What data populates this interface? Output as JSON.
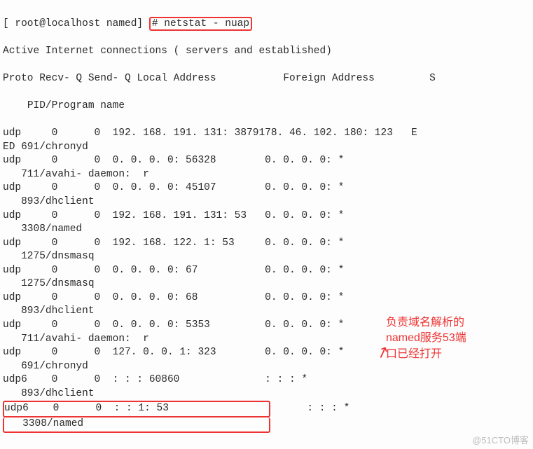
{
  "prompt_prefix": "[ root@localhost named]",
  "prompt_hash": "# ",
  "command": "netstat - nuap",
  "subtitle": "Active Internet connections ( servers and established)",
  "header": {
    "proto": "Proto",
    "recvq": "Recv- Q",
    "sendq": "Send- Q",
    "local": "Local Address",
    "foreign": "Foreign Address",
    "state": "S",
    "pid": "PID/Program name"
  },
  "rows": [
    {
      "proto": "udp",
      "recvq": "0",
      "sendq": "0",
      "local": "192. 168. 191. 131: 38791",
      "foreign": "78. 46. 102. 180: 123",
      "state": "E",
      "pid": "ED 691/chronyd"
    },
    {
      "proto": "udp",
      "recvq": "0",
      "sendq": "0",
      "local": "0. 0. 0. 0: 56328",
      "foreign": "0. 0. 0. 0: *",
      "state": "",
      "pid": "   711/avahi- daemon:  r"
    },
    {
      "proto": "udp",
      "recvq": "0",
      "sendq": "0",
      "local": "0. 0. 0. 0: 45107",
      "foreign": "0. 0. 0. 0: *",
      "state": "",
      "pid": "   893/dhclient"
    },
    {
      "proto": "udp",
      "recvq": "0",
      "sendq": "0",
      "local": "192. 168. 191. 131: 53",
      "foreign": "0. 0. 0. 0: *",
      "state": "",
      "pid": "   3308/named"
    },
    {
      "proto": "udp",
      "recvq": "0",
      "sendq": "0",
      "local": "192. 168. 122. 1: 53",
      "foreign": "0. 0. 0. 0: *",
      "state": "",
      "pid": "   1275/dnsmasq"
    },
    {
      "proto": "udp",
      "recvq": "0",
      "sendq": "0",
      "local": "0. 0. 0. 0: 67",
      "foreign": "0. 0. 0. 0: *",
      "state": "",
      "pid": "   1275/dnsmasq"
    },
    {
      "proto": "udp",
      "recvq": "0",
      "sendq": "0",
      "local": "0. 0. 0. 0: 68",
      "foreign": "0. 0. 0. 0: *",
      "state": "",
      "pid": "   893/dhclient"
    },
    {
      "proto": "udp",
      "recvq": "0",
      "sendq": "0",
      "local": "0. 0. 0. 0: 5353",
      "foreign": "0. 0. 0. 0: *",
      "state": "",
      "pid": "   711/avahi- daemon:  r"
    },
    {
      "proto": "udp",
      "recvq": "0",
      "sendq": "0",
      "local": "127. 0. 0. 1: 323",
      "foreign": "0. 0. 0. 0: *",
      "state": "",
      "pid": "   691/chronyd"
    },
    {
      "proto": "udp6",
      "recvq": "0",
      "sendq": "0",
      "local": ": : : 60860",
      "foreign": ": : : *",
      "state": "",
      "pid": "   893/dhclient"
    },
    {
      "proto": "udp6",
      "recvq": "0",
      "sendq": "0",
      "local": ": : 1: 53",
      "foreign": ": : : *",
      "state": "",
      "pid": "   3308/named"
    }
  ],
  "annotation": {
    "l1": "负责域名解析的",
    "l2": "named服务53端",
    "l3": "口已经打开"
  },
  "watermark": "@51CTO博客"
}
